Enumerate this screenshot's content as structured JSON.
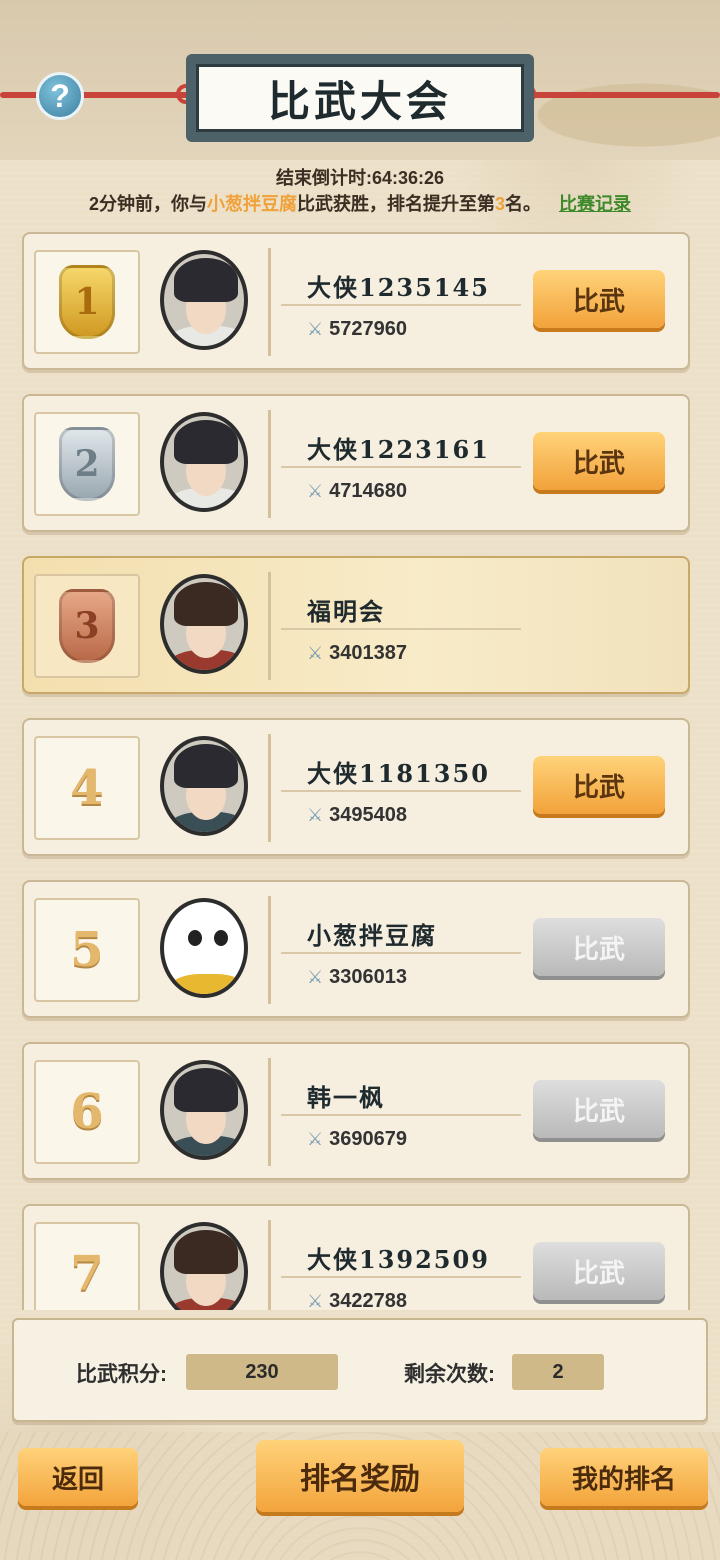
{
  "header": {
    "title": "比武大会",
    "help_icon": "?"
  },
  "countdown": {
    "label": "结束倒计时:",
    "time": "64:36:26"
  },
  "notice": {
    "prefix": "2分钟前，你与",
    "opponent": "小葱拌豆腐",
    "middle": "比武获胜，排名提升至第",
    "rank": "3",
    "suffix": "名。",
    "record_link": "比赛记录"
  },
  "rows": [
    {
      "rank": "1",
      "name": "大侠1235145",
      "power": "5727960",
      "button": "比武",
      "button_enabled": true,
      "medal": "gold",
      "avatar": "swordsman"
    },
    {
      "rank": "2",
      "name": "大侠1223161",
      "power": "4714680",
      "button": "比武",
      "button_enabled": true,
      "medal": "silver",
      "avatar": "swordsman"
    },
    {
      "rank": "3",
      "name": "福明会",
      "power": "3401387",
      "button": "",
      "button_enabled": false,
      "medal": "bronze",
      "avatar": "warrior",
      "is_me": true
    },
    {
      "rank": "4",
      "name": "大侠1181350",
      "power": "3495408",
      "button": "比武",
      "button_enabled": true,
      "medal": "",
      "avatar": "scholar"
    },
    {
      "rank": "5",
      "name": "小葱拌豆腐",
      "power": "3306013",
      "button": "比武",
      "button_enabled": false,
      "medal": "",
      "avatar": "panda"
    },
    {
      "rank": "6",
      "name": "韩一枫",
      "power": "3690679",
      "button": "比武",
      "button_enabled": false,
      "medal": "",
      "avatar": "scholar"
    },
    {
      "rank": "7",
      "name": "大侠1392509",
      "power": "3422788",
      "button": "比武",
      "button_enabled": false,
      "medal": "",
      "avatar": "warrior"
    }
  ],
  "status": {
    "score_label": "比武积分:",
    "score_value": "230",
    "remaining_label": "剩余次数:",
    "remaining_value": "2"
  },
  "bottom_buttons": {
    "back": "返回",
    "rank_reward": "排名奖励",
    "my_rank": "我的排名"
  },
  "colors": {
    "accent_orange": "#f2a23a",
    "highlight_text": "#f0a23a",
    "record_link": "#3e8a2a",
    "disabled_button": "#b9b9b9"
  }
}
